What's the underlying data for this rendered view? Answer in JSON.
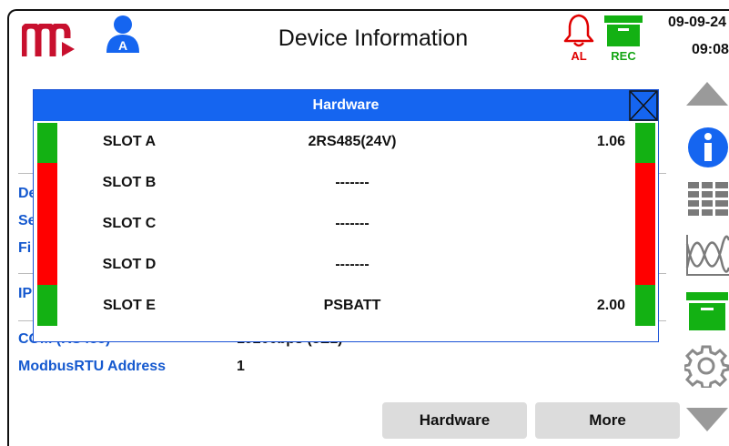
{
  "header": {
    "title": "Device Information",
    "user_letter": "A",
    "alarm_label": "AL",
    "rec_label": "REC",
    "date": "09-09-24",
    "time": "09:08"
  },
  "colors": {
    "brand": "#c8102e",
    "accent_blue": "#1565f0",
    "ok_green": "#13b113",
    "bad_red": "#ff0000",
    "alarm_red": "#e00000",
    "label_blue": "#1559cf"
  },
  "background_info": {
    "rows": [
      {
        "label": "De",
        "value": ""
      },
      {
        "label": "Se",
        "value": ""
      },
      {
        "label": "Fi",
        "value": ""
      },
      {
        "label": "IP",
        "value": ""
      },
      {
        "label": "COM (RS485)",
        "value": "19200bps (8E1)"
      },
      {
        "label": "ModbusRTU Address",
        "value": "1"
      }
    ]
  },
  "buttons": {
    "hardware": "Hardware",
    "more": "More"
  },
  "dialog": {
    "title": "Hardware",
    "slots": [
      {
        "name": "SLOT A",
        "module": "2RS485(24V)",
        "version": "1.06",
        "status": "ok"
      },
      {
        "name": "SLOT B",
        "module": "-------",
        "version": "",
        "status": "bad"
      },
      {
        "name": "SLOT C",
        "module": "-------",
        "version": "",
        "status": "bad"
      },
      {
        "name": "SLOT D",
        "module": "-------",
        "version": "",
        "status": "bad"
      },
      {
        "name": "SLOT E",
        "module": "PSBATT",
        "version": "2.00",
        "status": "ok"
      }
    ]
  },
  "toolbar": {
    "icons": [
      "scroll-up-icon",
      "info-icon",
      "table-icon",
      "waveform-icon",
      "archive-icon",
      "settings-gear-icon",
      "scroll-down-icon"
    ]
  }
}
